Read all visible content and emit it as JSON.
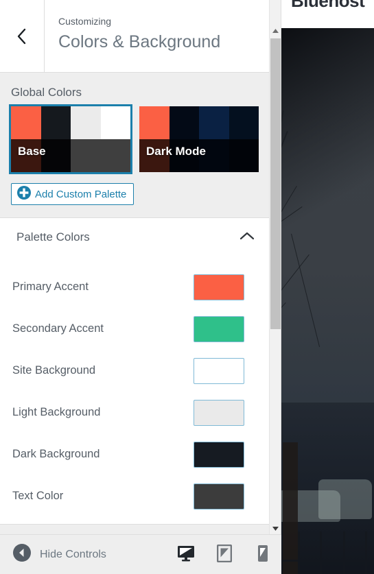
{
  "header": {
    "back_icon": "chevron-left-icon",
    "eyebrow": "Customizing",
    "title": "Colors & Background"
  },
  "global_colors": {
    "section_label": "Global Colors",
    "palettes": [
      {
        "name": "Base",
        "selected": true,
        "swatches": [
          "#fb6044",
          "#15191e",
          "#ebebeb",
          "#ffffff",
          "#3b170f",
          "#050507",
          "#3f3f3f",
          "#3f3f3f"
        ]
      },
      {
        "name": "Dark Mode",
        "selected": false,
        "swatches": [
          "#fb6044",
          "#030a16",
          "#0a2143",
          "#04101f",
          "#3b170f",
          "#01040a",
          "#01060f",
          "#010409"
        ]
      }
    ],
    "add_palette_label": "Add Custom Palette",
    "add_palette_icon": "plus-circle-icon",
    "accent_color": "#1b7fab"
  },
  "palette_colors": {
    "title": "Palette Colors",
    "expanded": true,
    "toggle_icon": "chevron-up-icon",
    "rows": [
      {
        "label": "Primary Accent",
        "color": "#fb6044"
      },
      {
        "label": "Secondary Accent",
        "color": "#2fc08a"
      },
      {
        "label": "Site Background",
        "color": "#ffffff"
      },
      {
        "label": "Light Background",
        "color": "#eaeaea"
      },
      {
        "label": "Dark Background",
        "color": "#161b22"
      },
      {
        "label": "Text Color",
        "color": "#3c3c3c"
      }
    ]
  },
  "footer": {
    "hide_controls_label": "Hide Controls",
    "collapse_icon": "collapse-left-icon",
    "devices": [
      {
        "name": "desktop",
        "icon": "desktop-icon",
        "active": true
      },
      {
        "name": "tablet",
        "icon": "tablet-icon",
        "active": false
      },
      {
        "name": "mobile",
        "icon": "mobile-icon",
        "active": false
      }
    ]
  },
  "scrollbar": {
    "up_icon": "triangle-up-icon",
    "down_icon": "triangle-down-icon"
  },
  "preview": {
    "site_title": "Bluehost"
  }
}
